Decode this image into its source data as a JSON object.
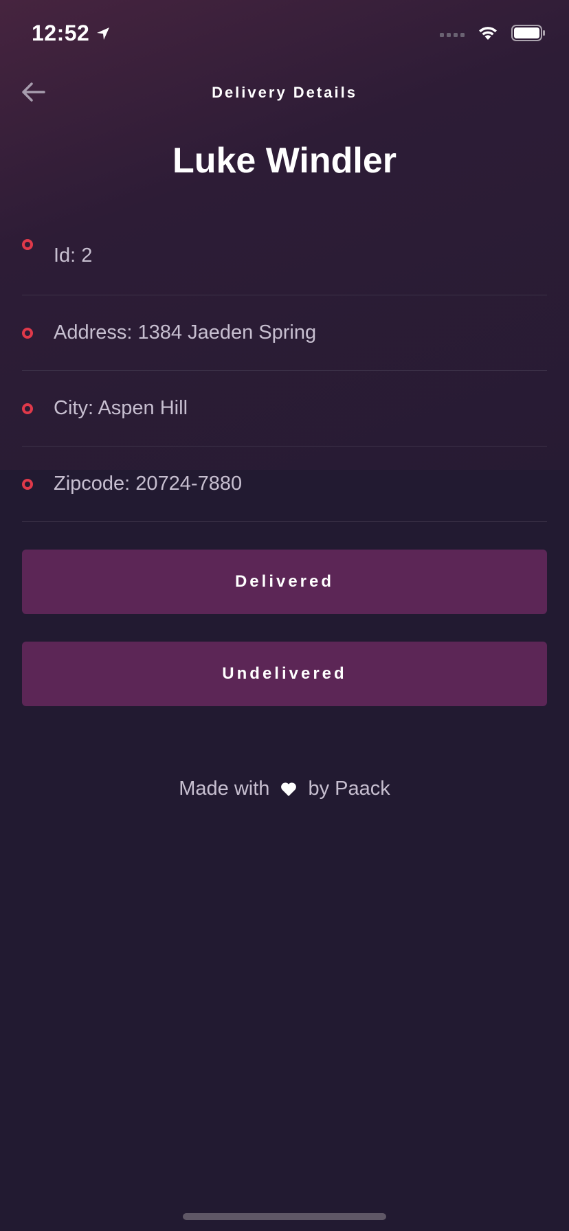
{
  "status_bar": {
    "time": "12:52"
  },
  "nav": {
    "title": "Delivery Details",
    "back_icon": "arrow-left-icon"
  },
  "customer": {
    "name": "Luke Windler"
  },
  "details": [
    {
      "label": "Id: 2"
    },
    {
      "label": "Address: 1384 Jaeden Spring"
    },
    {
      "label": "City: Aspen Hill"
    },
    {
      "label": "Zipcode: 20724-7880"
    }
  ],
  "actions": {
    "delivered_label": "Delivered",
    "undelivered_label": "Undelivered"
  },
  "footer": {
    "prefix": "Made with",
    "suffix": "by Paack",
    "icon": "heart-icon"
  },
  "colors": {
    "accent_button": "#5c2656",
    "bullet": "#e0394a",
    "background": "#221a31"
  }
}
